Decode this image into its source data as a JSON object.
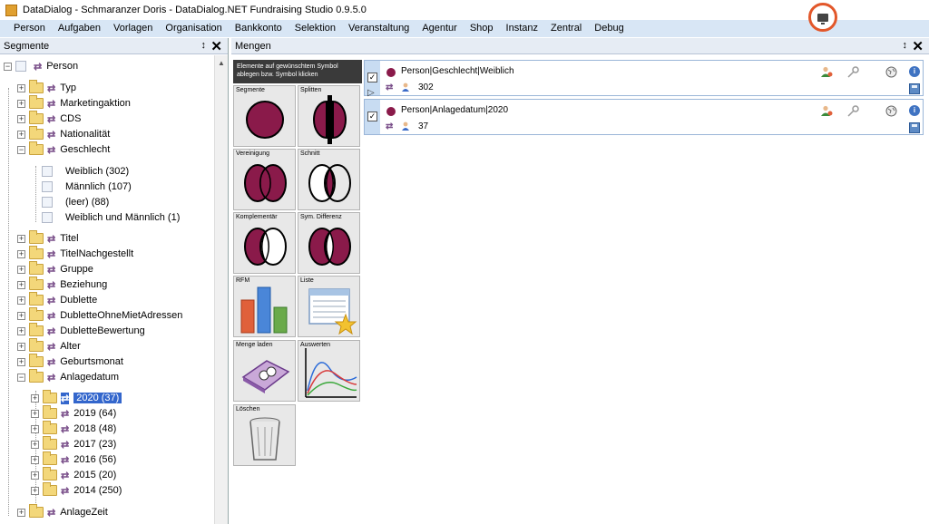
{
  "window": {
    "title": "DataDialog - Schmaranzer Doris - DataDialog.NET Fundraising Studio 0.9.5.0"
  },
  "menu": [
    "Person",
    "Aufgaben",
    "Vorlagen",
    "Organisation",
    "Bankkonto",
    "Selektion",
    "Veranstaltung",
    "Agentur",
    "Shop",
    "Instanz",
    "Zentral",
    "Debug"
  ],
  "left_panel": {
    "title": "Segmente",
    "pin": "↕",
    "close": "✕",
    "root": "Person",
    "groups": [
      "Typ",
      "Marketingaktion",
      "CDS",
      "Nationalität",
      "Geschlecht"
    ],
    "geschlecht_children": [
      "Weiblich (302)",
      "Männlich (107)",
      "(leer) (88)",
      "Weiblich und Männlich (1)"
    ],
    "groups2": [
      "Titel",
      "TitelNachgestellt",
      "Gruppe",
      "Beziehung",
      "Dublette",
      "DubletteOhneMietAdressen",
      "DubletteBewertung",
      "Alter",
      "Geburtsmonat",
      "Anlagedatum"
    ],
    "anlagedatum_children": [
      "2020 (37)",
      "2019 (64)",
      "2018 (48)",
      "2017 (23)",
      "2016 (56)",
      "2015 (20)",
      "2014 (250)"
    ],
    "last_group": "AnlageZeit"
  },
  "right_panel": {
    "title": "Mengen",
    "pin": "↕",
    "close": "✕",
    "tooltip": "Elemente auf gewünschtem Symbol ablegen bzw. Symbol klicken",
    "tiles": [
      "Segmente",
      "Splitten",
      "Vereinigung",
      "Schnitt",
      "Komplementär",
      "Sym. Differenz",
      "RFM",
      "Liste",
      "Menge laden",
      "Auswerten",
      "Löschen"
    ],
    "sets": [
      {
        "name": "Person|Geschlecht|Weiblich",
        "count": "302",
        "checked": "✓"
      },
      {
        "name": "Person|Anlagedatum|2020",
        "count": "37",
        "checked": "✓"
      }
    ]
  },
  "colors": {
    "accent": "#8a1a4a",
    "menubar": "#d8e6f5",
    "selection": "#3366cc",
    "record": "#e2572a"
  }
}
